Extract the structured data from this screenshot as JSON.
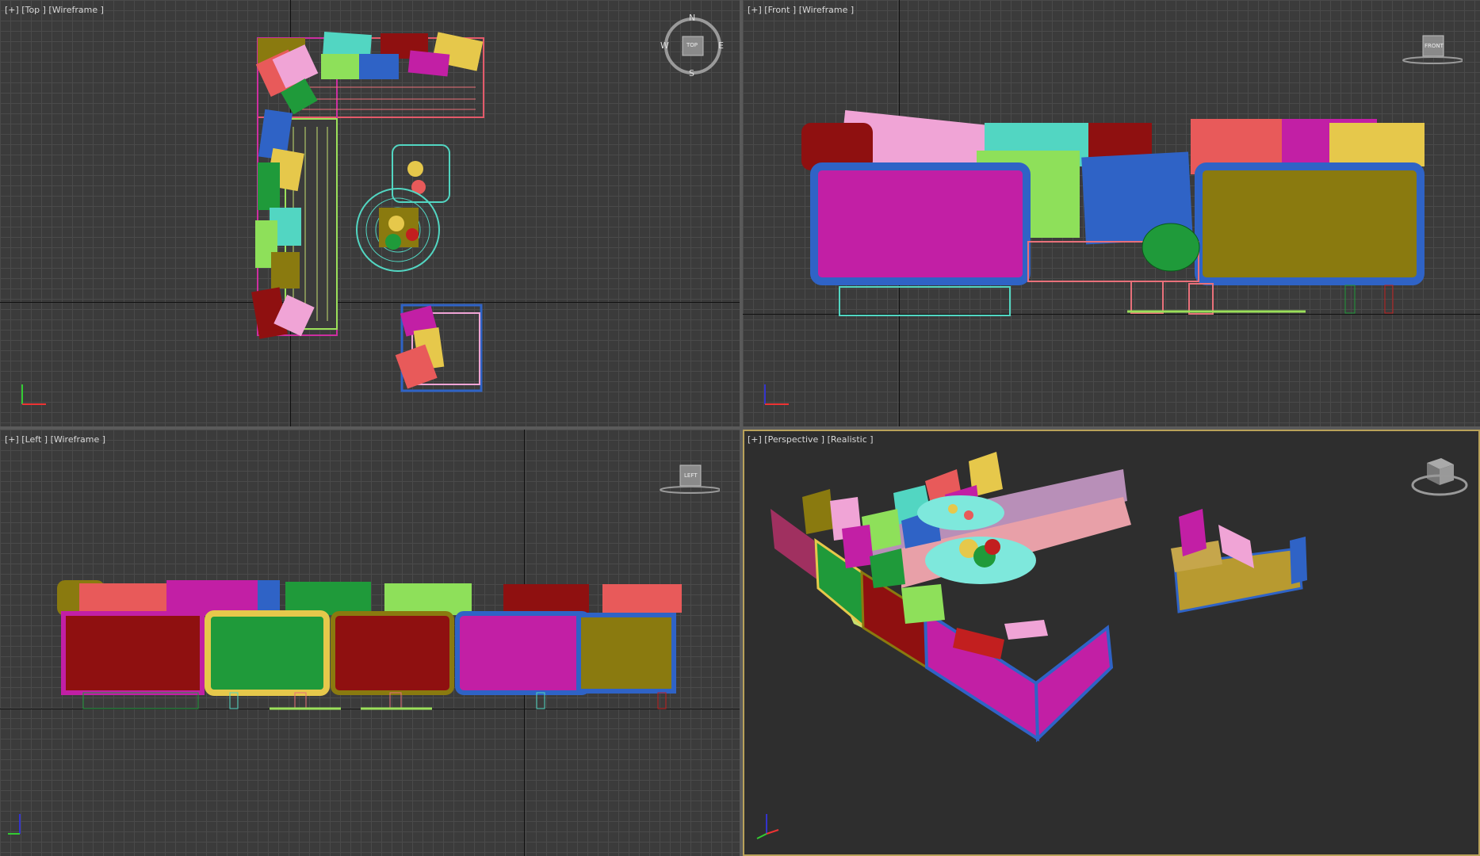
{
  "viewports": {
    "top": {
      "label": "[+] [Top ] [Wireframe ]",
      "compass": {
        "n": "N",
        "s": "S",
        "e": "E",
        "w": "W",
        "cube": "TOP"
      }
    },
    "front": {
      "label": "[+] [Front ] [Wireframe ]",
      "cube": "FRONT"
    },
    "left": {
      "label": "[+] [Left ] [Wireframe ]",
      "cube": "LEFT"
    },
    "perspective": {
      "label": "[+] [Perspective ] [Realistic ]"
    }
  },
  "icons": [
    "viewcube-icon",
    "compass-icon",
    "axis-tripod-icon"
  ],
  "colors": {
    "grid_bg": "#3b3b3b",
    "grid_line": "#4a4a4a",
    "active_border": "#b9a25a",
    "persp_bg": "#2e2e2e"
  }
}
